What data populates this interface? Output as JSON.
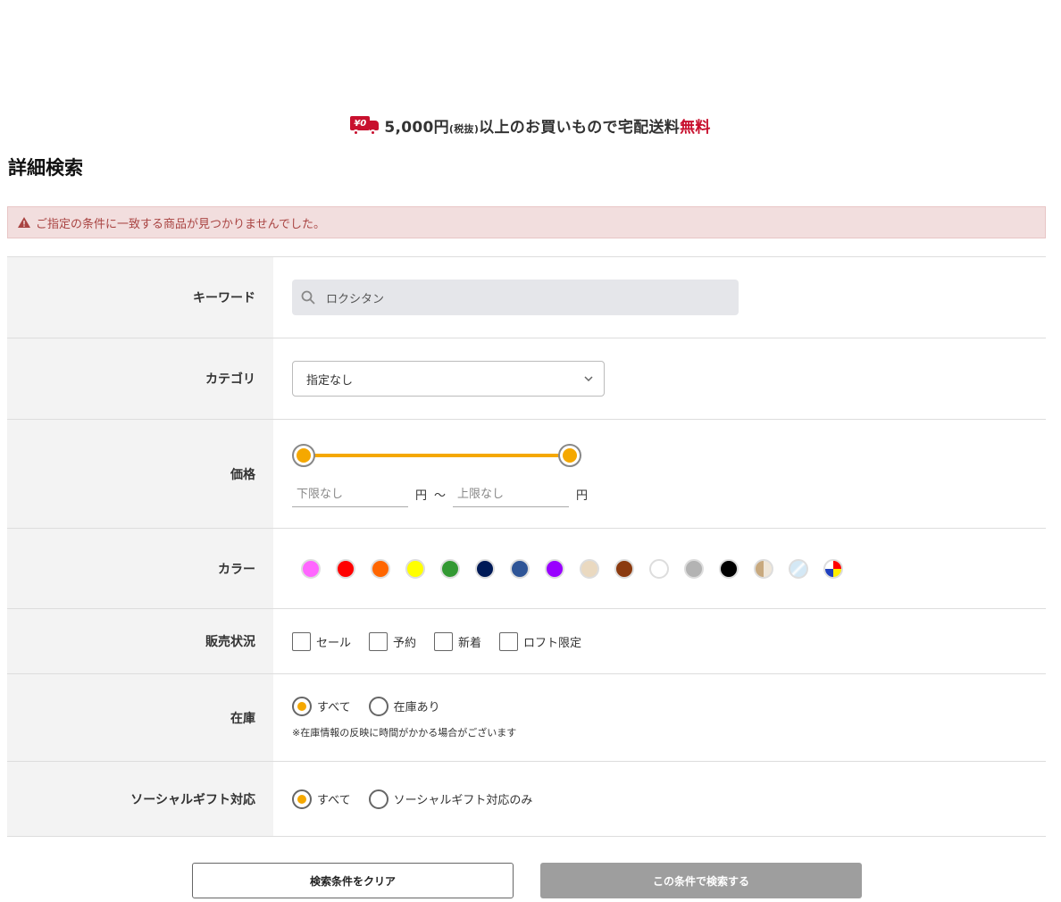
{
  "banner": {
    "truck_label": "¥0",
    "amount": "5,000円",
    "tax": "(税抜)",
    "text": "以上のお買いもので宅配送料",
    "free": "無料"
  },
  "page_title": "詳細検索",
  "alert": {
    "message": "ご指定の条件に一致する商品が見つかりませんでした。"
  },
  "form": {
    "keyword": {
      "label": "キーワード",
      "value": "ロクシタン"
    },
    "category": {
      "label": "カテゴリ",
      "selected": "指定なし"
    },
    "price": {
      "label": "価格",
      "min_placeholder": "下限なし",
      "max_placeholder": "上限なし",
      "unit": "円",
      "separator": "～",
      "slider_min": 0,
      "slider_max": 1
    },
    "color": {
      "label": "カラー",
      "swatches": [
        "#ff66ff",
        "#ff0000",
        "#ff6600",
        "#ffff00",
        "#339933",
        "#001a57",
        "#2f5597",
        "#9900ff",
        "#ead9c0",
        "#8b3a0f",
        "#ffffff",
        "#b3b3b3",
        "#000000",
        "#c8a97e",
        "#d4e8f5",
        "multi"
      ]
    },
    "sales_status": {
      "label": "販売状況",
      "options": [
        "セール",
        "予約",
        "新着",
        "ロフト限定"
      ]
    },
    "stock": {
      "label": "在庫",
      "options": [
        "すべて",
        "在庫あり"
      ],
      "selected": 0,
      "note": "※在庫情報の反映に時間がかかる場合がございます"
    },
    "social_gift": {
      "label": "ソーシャルギフト対応",
      "options": [
        "すべて",
        "ソーシャルギフト対応のみ"
      ],
      "selected": 0
    }
  },
  "buttons": {
    "clear": "検索条件をクリア",
    "search": "この条件で検索する"
  },
  "colors": {
    "accent": "#f5a800",
    "alert_bg": "#f2dede",
    "alert_text": "#a94442",
    "brand_red": "#c8102e"
  }
}
